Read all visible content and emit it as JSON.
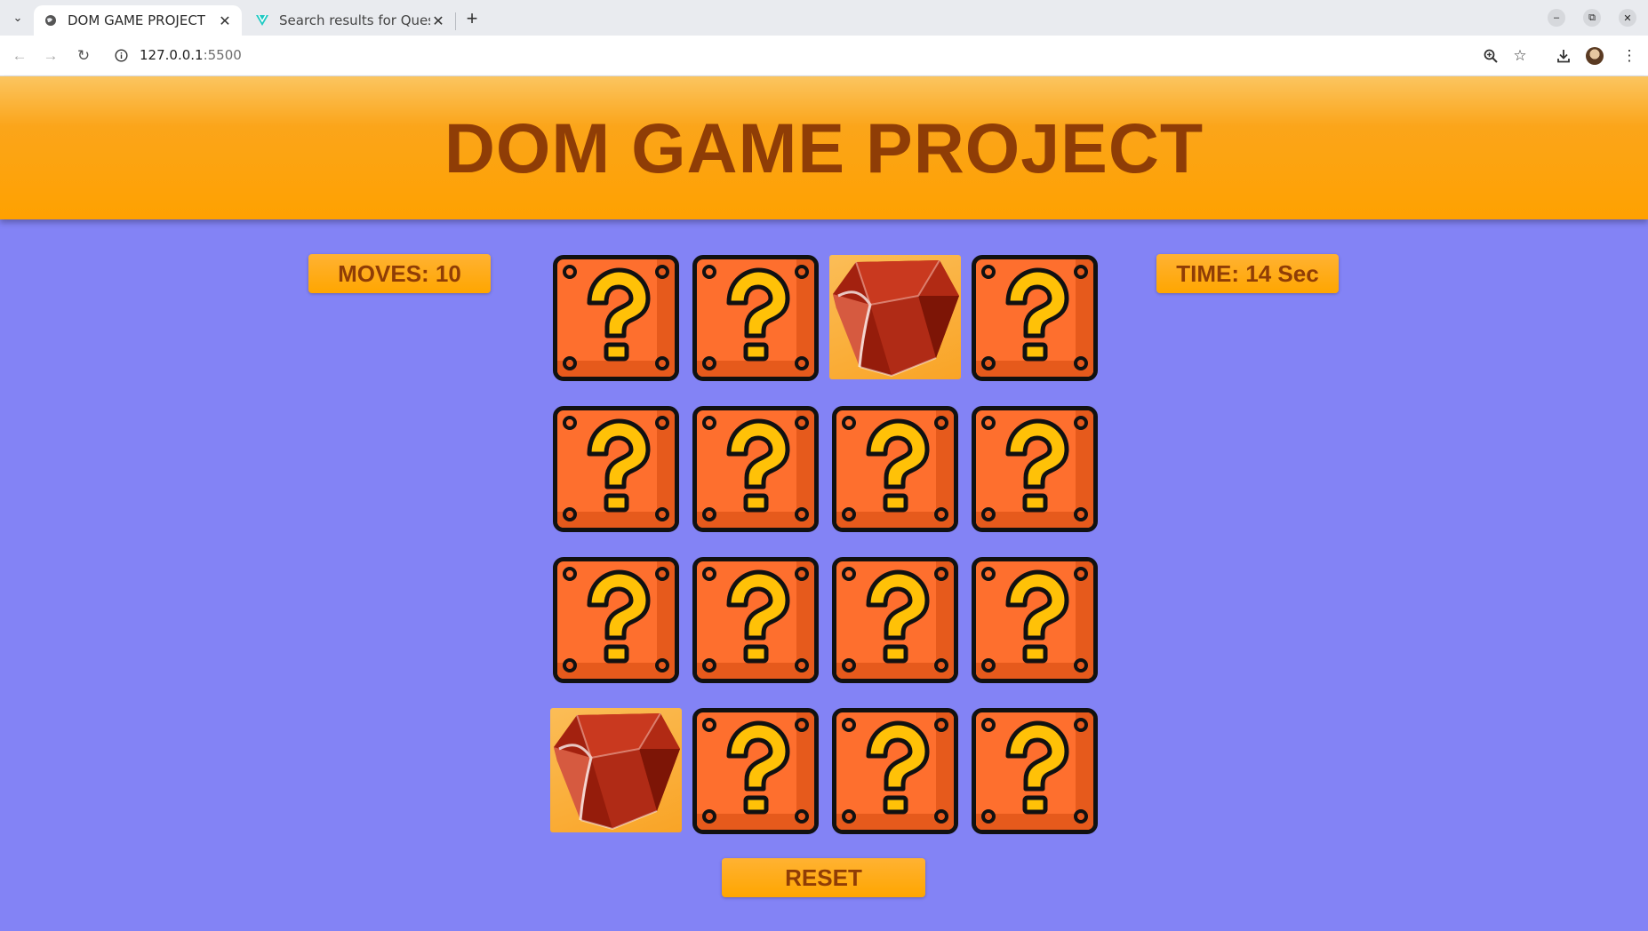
{
  "browser": {
    "tabs": [
      {
        "title": "DOM GAME PROJECT",
        "active": true,
        "favicon": "globe-icon"
      },
      {
        "title": "Search results for Questi",
        "active": false,
        "favicon": "vuetify-icon"
      }
    ],
    "url": {
      "host": "127.0.0.1",
      "port": ":5500"
    }
  },
  "page": {
    "title": "DOM GAME PROJECT",
    "moves_label": "MOVES: 10",
    "time_label": "TIME: 14 Sec",
    "reset_label": "RESET"
  },
  "board": {
    "columns": 4,
    "rows": 4,
    "cards": [
      {
        "state": "hidden"
      },
      {
        "state": "hidden"
      },
      {
        "state": "revealed",
        "image": "ruby-gem"
      },
      {
        "state": "hidden"
      },
      {
        "state": "hidden"
      },
      {
        "state": "hidden"
      },
      {
        "state": "hidden"
      },
      {
        "state": "hidden"
      },
      {
        "state": "hidden"
      },
      {
        "state": "hidden"
      },
      {
        "state": "hidden"
      },
      {
        "state": "hidden"
      },
      {
        "state": "revealed",
        "image": "ruby-gem"
      },
      {
        "state": "hidden"
      },
      {
        "state": "hidden"
      },
      {
        "state": "hidden"
      }
    ]
  },
  "colors": {
    "page_background": "#8383f5",
    "header": "#ffa100",
    "title_text": "#8f3d06",
    "card_face": "#fe6f2e",
    "question_mark": "#ffc107"
  }
}
